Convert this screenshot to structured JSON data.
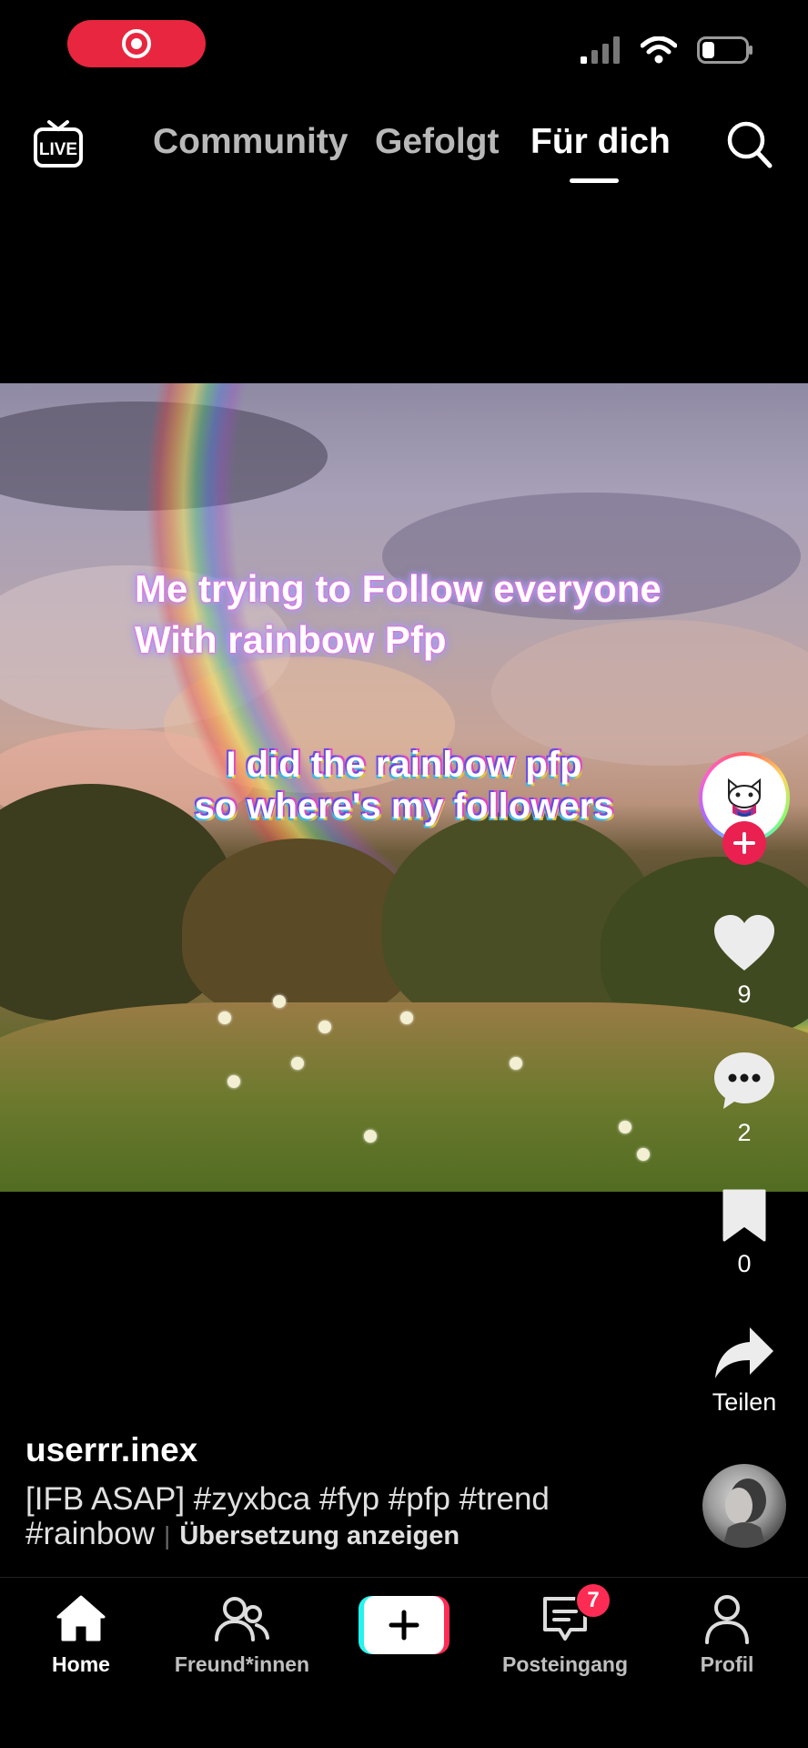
{
  "status": {
    "recording_icon": "record-icon",
    "signal_icon": "signal-icon",
    "wifi_icon": "wifi-icon",
    "battery_icon": "battery-icon"
  },
  "top_nav": {
    "live_label": "LIVE",
    "tabs": [
      {
        "label": "Community",
        "active": false
      },
      {
        "label": "Gefolgt",
        "active": false
      },
      {
        "label": "Für dich",
        "active": true
      }
    ],
    "search_icon": "search-icon"
  },
  "video": {
    "caption_line1": "Me trying to Follow everyone",
    "caption_line2": "With rainbow Pfp",
    "overlay_line1": "I did the rainbow pfp",
    "overlay_line2": "so where's my followers"
  },
  "actions": {
    "likes": "9",
    "comments": "2",
    "saves": "0",
    "share_label": "Teilen"
  },
  "post": {
    "username": "userrr.inex",
    "description": "[IFB ASAP] #zyxbca #fyp #pfp #trend #rainbow",
    "translate_label": "Übersetzung anzeigen"
  },
  "bottom_nav": {
    "home": "Home",
    "friends": "Freund*innen",
    "inbox": "Posteingang",
    "inbox_badge": "7",
    "profile": "Profil"
  },
  "colors": {
    "accent": "#fe2c55",
    "accent_cyan": "#25f4ee",
    "record_red": "#e8263f"
  }
}
